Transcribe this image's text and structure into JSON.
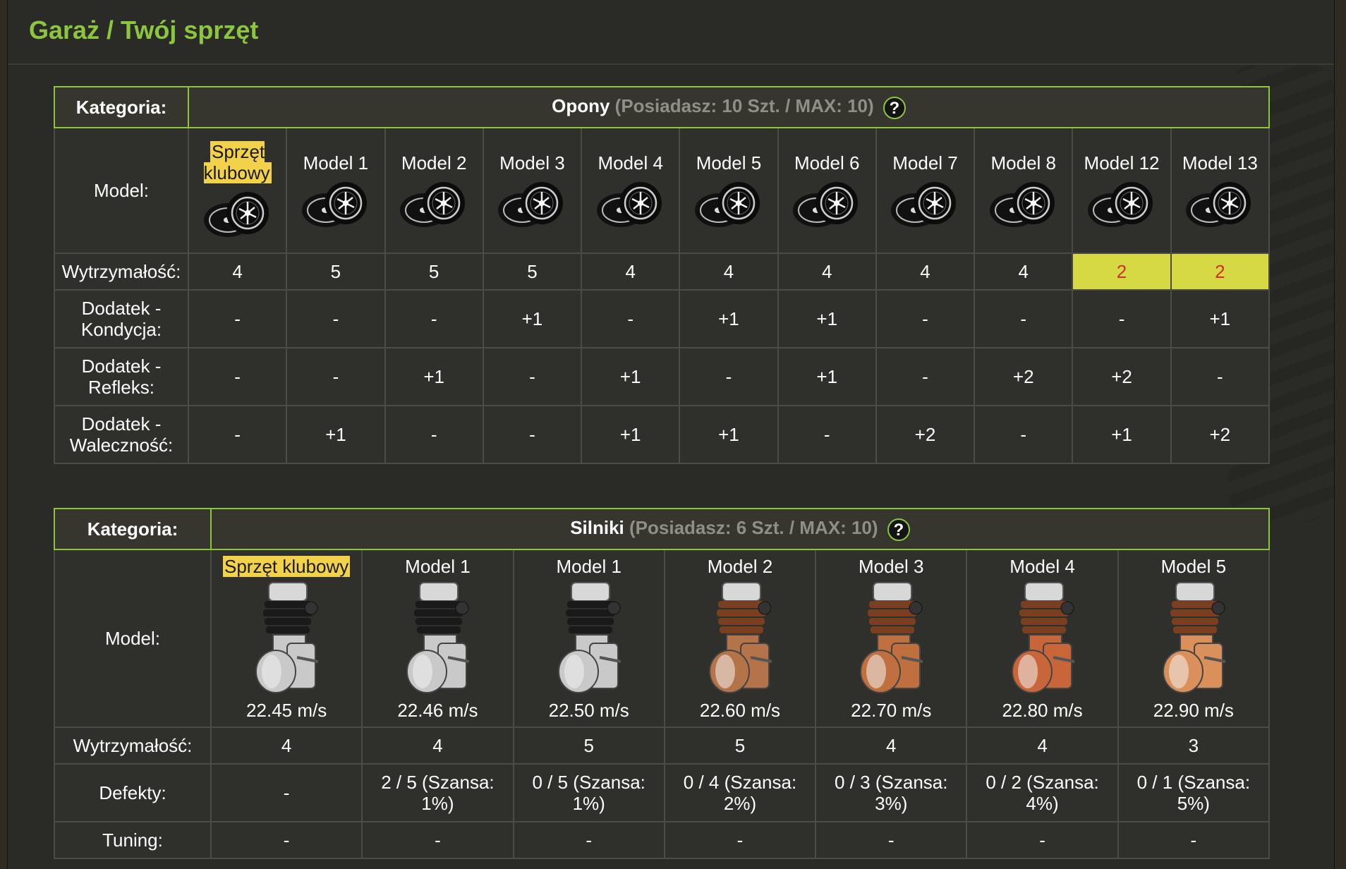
{
  "page_title": "Garaż / Twój sprzęt",
  "colors": {
    "accent": "#8cc63f",
    "highlight": "#f2d24a",
    "warn_bg": "#d6d944",
    "warn_text": "#cc3322"
  },
  "tires": {
    "category_label": "Kategoria:",
    "category_name": "Opony",
    "count_text": "(Posiadasz: 10 Szt. / MAX: 10)",
    "help_label": "?",
    "row_labels": {
      "model": "Model:",
      "durability": "Wytrzymałość:",
      "condition": "Dodatek - Kondycja:",
      "reflex": "Dodatek - Refleks:",
      "bravery": "Dodatek - Waleczność:"
    },
    "items": [
      {
        "name": "Sprzęt klubowy",
        "durability": "4",
        "condition": "-",
        "reflex": "-",
        "bravery": "-"
      },
      {
        "name": "Model 1",
        "durability": "5",
        "condition": "-",
        "reflex": "-",
        "bravery": "+1"
      },
      {
        "name": "Model 2",
        "durability": "5",
        "condition": "-",
        "reflex": "+1",
        "bravery": "-"
      },
      {
        "name": "Model 3",
        "durability": "5",
        "condition": "+1",
        "reflex": "-",
        "bravery": "-"
      },
      {
        "name": "Model 4",
        "durability": "4",
        "condition": "-",
        "reflex": "+1",
        "bravery": "+1"
      },
      {
        "name": "Model 5",
        "durability": "4",
        "condition": "+1",
        "reflex": "-",
        "bravery": "+1"
      },
      {
        "name": "Model 6",
        "durability": "4",
        "condition": "+1",
        "reflex": "+1",
        "bravery": "-"
      },
      {
        "name": "Model 7",
        "durability": "4",
        "condition": "-",
        "reflex": "-",
        "bravery": "+2"
      },
      {
        "name": "Model 8",
        "durability": "4",
        "condition": "-",
        "reflex": "+2",
        "bravery": "-"
      },
      {
        "name": "Model 12",
        "durability": "2",
        "condition": "-",
        "reflex": "+2",
        "bravery": "+1"
      },
      {
        "name": "Model 13",
        "durability": "2",
        "condition": "+1",
        "reflex": "-",
        "bravery": "+2"
      }
    ]
  },
  "engines": {
    "category_label": "Kategoria:",
    "category_name": "Silniki",
    "count_text": "(Posiadasz: 6 Szt. / MAX: 10)",
    "help_label": "?",
    "row_labels": {
      "model": "Model:",
      "durability": "Wytrzymałość:",
      "defects": "Defekty:",
      "tuning": "Tuning:"
    },
    "items": [
      {
        "name": "Sprzęt klubowy",
        "speed": "22.45 m/s",
        "durability": "4",
        "defects": "-",
        "tuning": "-",
        "color": "#c9c9c9"
      },
      {
        "name": "Model 1",
        "speed": "22.46 m/s",
        "durability": "4",
        "defects": "2 / 5 (Szansa: 1%)",
        "tuning": "-",
        "color": "#c9c9c9"
      },
      {
        "name": "Model 1",
        "speed": "22.50 m/s",
        "durability": "5",
        "defects": "0 / 5 (Szansa: 1%)",
        "tuning": "-",
        "color": "#c9c9c9"
      },
      {
        "name": "Model 2",
        "speed": "22.60 m/s",
        "durability": "5",
        "defects": "0 / 4 (Szansa: 2%)",
        "tuning": "-",
        "color": "#b5734a"
      },
      {
        "name": "Model 3",
        "speed": "22.70 m/s",
        "durability": "4",
        "defects": "0 / 3 (Szansa: 3%)",
        "tuning": "-",
        "color": "#c0703f"
      },
      {
        "name": "Model 4",
        "speed": "22.80 m/s",
        "durability": "4",
        "defects": "0 / 2 (Szansa: 4%)",
        "tuning": "-",
        "color": "#c8663a"
      },
      {
        "name": "Model 5",
        "speed": "22.90 m/s",
        "durability": "3",
        "defects": "0 / 1 (Szansa: 5%)",
        "tuning": "-",
        "color": "#d9905a"
      }
    ]
  }
}
